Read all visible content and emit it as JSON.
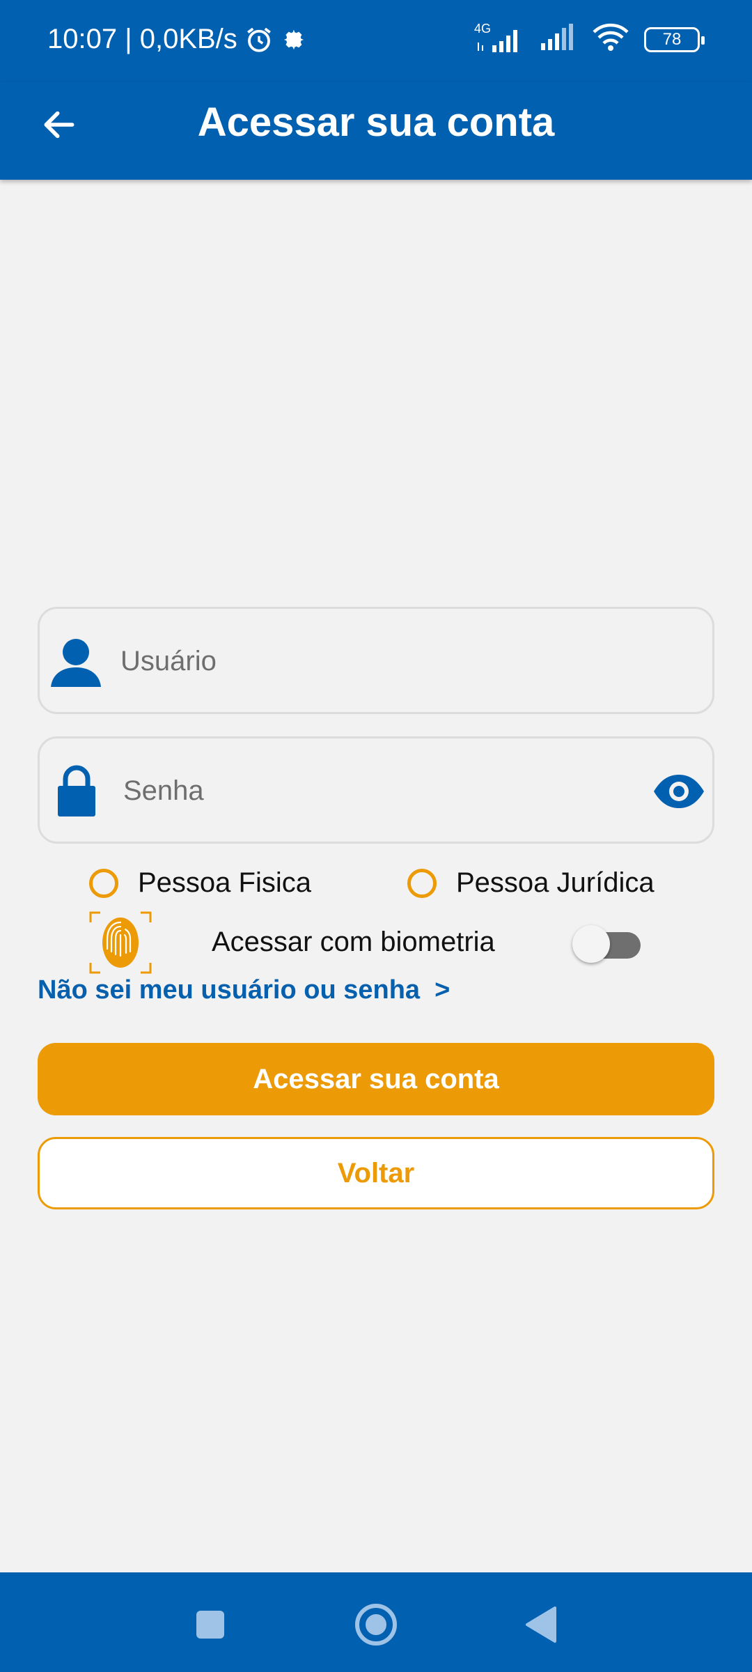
{
  "status_bar": {
    "time_speed": "10:07 | 0,0KB/s",
    "network_label": "4G",
    "battery": "78"
  },
  "header": {
    "title": "Acessar sua conta"
  },
  "login_form": {
    "username_placeholder": "Usuário",
    "password_placeholder": "Senha",
    "person_type_options": [
      "Pessoa Fisica",
      "Pessoa Jurídica"
    ],
    "biometric_label": "Acessar com biometria",
    "biometric_enabled": false,
    "forgot_link": "Não sei meu usuário ou senha  >",
    "submit_label": "Acessar sua conta",
    "back_label": "Voltar"
  },
  "colors": {
    "primary_blue": "#0160b0",
    "accent_orange": "#ec9a06",
    "background": "#f2f2f2",
    "link_blue": "#0760ad"
  },
  "icons": {
    "status": [
      "alarm-icon",
      "settings-gear-icon",
      "signal-icon",
      "wifi-icon",
      "battery-icon"
    ],
    "header": "back-arrow-icon",
    "username": "user-icon",
    "password": "lock-icon",
    "show_password": "eye-icon",
    "biometric": "fingerprint-icon",
    "navigation": [
      "recent-apps-icon",
      "home-icon",
      "back-triangle-icon"
    ]
  }
}
